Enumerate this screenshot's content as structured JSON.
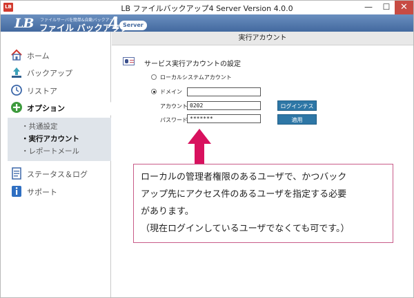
{
  "window": {
    "title": "LB ファイルバックアップ4 Server Version 4.0.0",
    "app_icon_text": "LB",
    "minimize_glyph": "—",
    "maximize_glyph": "☐",
    "close_glyph": "✕"
  },
  "banner": {
    "logo_lb": "LB",
    "tagline": "ファイルサーバを簡単&自動バックアップ",
    "name": "ファイル バックアップ",
    "version_digit": "4",
    "edition": "Server"
  },
  "sidebar": {
    "items": [
      {
        "label": "ホーム",
        "icon": "house-icon"
      },
      {
        "label": "バックアップ",
        "icon": "upload-arrow-icon"
      },
      {
        "label": "リストア",
        "icon": "clock-restore-icon"
      },
      {
        "label": "オプション",
        "icon": "plus-circle-icon"
      },
      {
        "label": "ステータス＆ログ",
        "icon": "log-sheet-icon"
      },
      {
        "label": "サポート",
        "icon": "info-icon"
      }
    ],
    "sub_items": [
      {
        "label": "・共通設定"
      },
      {
        "label": "・実行アカウント"
      },
      {
        "label": "・レポートメール"
      }
    ]
  },
  "content": {
    "header": "実行アカウント",
    "section_title": "サービス実行アカウントの設定",
    "local_system_label": "ローカルシステムアカウント",
    "domain_label": "ドメイン",
    "domain_value": "",
    "account_label": "アカウント",
    "account_value": "0202",
    "password_label": "パスワード",
    "password_value": "*******",
    "login_test_button": "ログインテスト",
    "apply_button": "適用"
  },
  "callout": {
    "lines": [
      "ローカルの管理者権限のあるユーザで、かつバック",
      "アップ先にアクセス件のあるユーザを指定する必要",
      "があります。",
      "（現在ログインしているユーザでなくても可です。）"
    ]
  },
  "colors": {
    "banner": "#43699f",
    "button": "#2e77a6",
    "arrow": "#d8115e",
    "callout_border": "#c85a88",
    "close_button": "#c74b43"
  }
}
